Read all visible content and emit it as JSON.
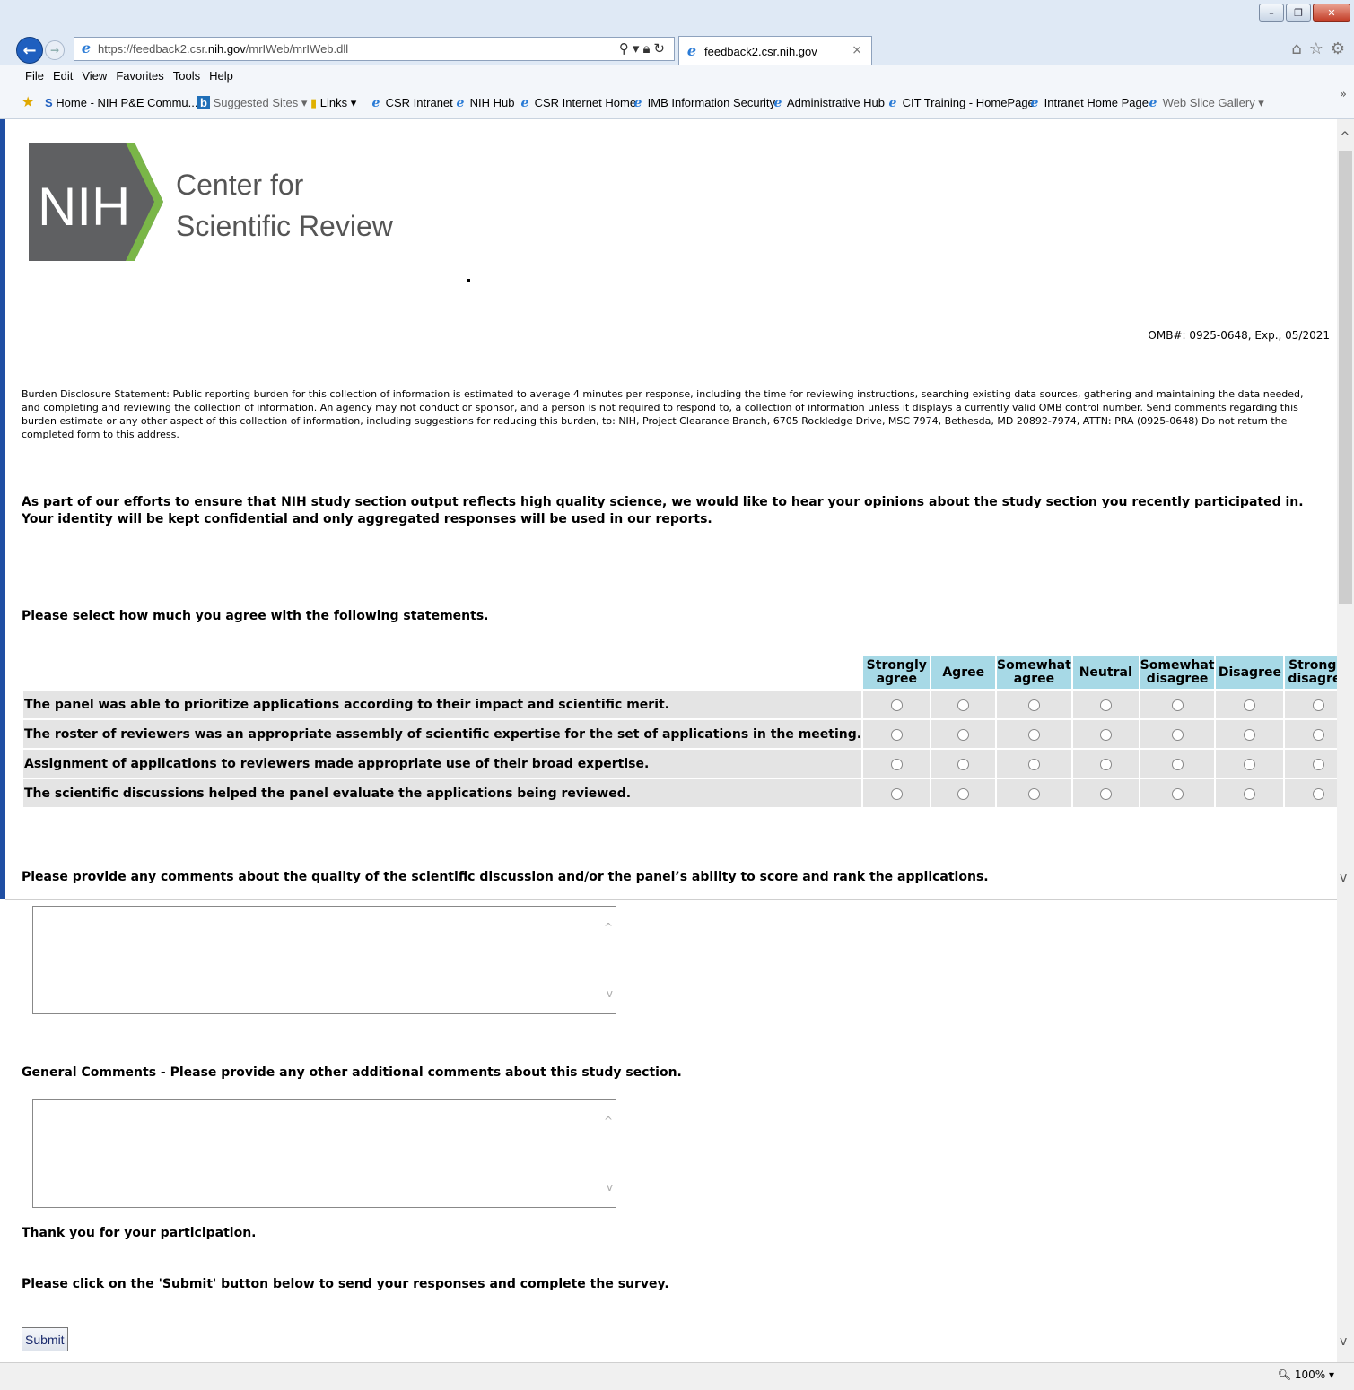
{
  "browser": {
    "url_prefix": "https://feedback2.csr.",
    "url_domain": "nih.gov",
    "url_path": "/mrIWeb/mrIWeb.dll",
    "tab_title": "feedback2.csr.nih.gov",
    "menu": [
      "File",
      "Edit",
      "View",
      "Favorites",
      "Tools",
      "Help"
    ],
    "favorites": [
      "Home - NIH P&E Commu...",
      "Suggested Sites ▾",
      "Links ▾",
      "CSR Intranet",
      "NIH Hub",
      "CSR Internet Home",
      "IMB Information Security",
      "Administrative Hub",
      "CIT Training - HomePage",
      "Intranet Home Page",
      "Web Slice Gallery ▾"
    ],
    "zoom": "100%"
  },
  "page": {
    "logo_line1": "Center for",
    "logo_line2": "Scientific Review",
    "logo_mark_text": "NIH",
    "omb": "OMB#: 0925-0648, Exp., 05/2021",
    "burden": "Burden Disclosure Statement: Public reporting burden for this collection of information is estimated to average 4 minutes per response, including the time for reviewing instructions, searching existing data sources, gathering and maintaining the data needed, and completing and reviewing the collection of information. An agency may not conduct or sponsor, and a person is not required to respond to, a collection of information unless it displays a currently valid OMB control number. Send comments regarding this burden estimate or any other aspect of this collection of information, including suggestions for reducing this burden, to: NIH, Project Clearance Branch, 6705 Rockledge Drive, MSC 7974, Bethesda, MD 20892-7974, ATTN: PRA (0925-0648) Do not return the completed form to this address.",
    "intro": "As part of our efforts to ensure that NIH study section output reflects high quality science, we would like to hear your opinions about the study section you recently participated in. Your identity will be kept confidential and only aggregated responses will be used in our reports.",
    "instruction": "Please select how much you agree with the following statements.",
    "scale": [
      "Strongly agree",
      "Agree",
      "Somewhat agree",
      "Neutral",
      "Somewhat disagree",
      "Disagree",
      "Strongly disagree"
    ],
    "statements": [
      "The panel was able to prioritize applications according to their impact and scientific merit.",
      "The roster of reviewers was an appropriate assembly of scientific expertise for the set of applications in the meeting.",
      "Assignment of applications to reviewers made appropriate use of their broad expertise.",
      "The scientific discussions helped the panel evaluate the applications being reviewed."
    ],
    "question1": "Please provide any comments about the quality of the scientific discussion and/or the panel’s ability to score and rank the applications.",
    "question2": "General Comments - Please provide any other additional comments about this study section.",
    "thanks": "Thank you for your participation.",
    "click_msg": "Please click on the 'Submit' button below to send your responses and complete the survey.",
    "submit_label": "Submit"
  },
  "colors": {
    "header_cell": "#a7d9e6",
    "row_cell": "#e4e4e4",
    "logo_gray": "#5f6062",
    "logo_green": "#7ab648"
  }
}
